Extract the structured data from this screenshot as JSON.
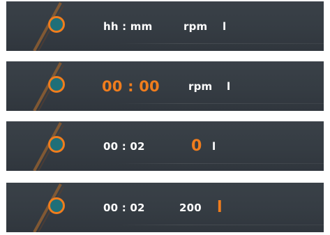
{
  "colors": {
    "panel": "#353c43",
    "accent": "#f07d1d",
    "knob_fill": "#1f6f78",
    "text": "#ffffff"
  },
  "icons": {
    "dial": "dial-knob-icon"
  },
  "screens": [
    {
      "time": "hh : mm",
      "rpm": "rpm",
      "liters": "l"
    },
    {
      "time": "00 : 00",
      "rpm": "rpm",
      "liters": "l"
    },
    {
      "time": "00 : 02",
      "rpm": "0",
      "liters": "l"
    },
    {
      "time": "00 : 02",
      "rpm": "200",
      "liters": "l"
    }
  ]
}
